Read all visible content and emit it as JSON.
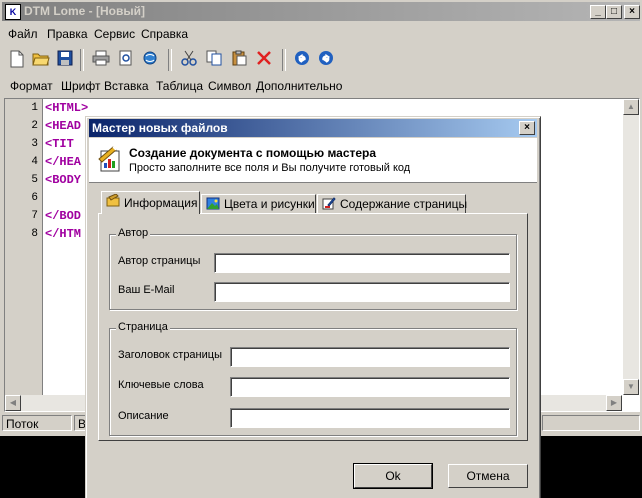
{
  "window": {
    "title": "DTM Lome - [Новый]"
  },
  "menu": [
    "Файл",
    "Правка",
    "Сервис",
    "Справка"
  ],
  "format_bar": [
    "Формат",
    "Шрифт",
    "Вставка",
    "Таблица",
    "Символ",
    "Дополнительно"
  ],
  "editor": {
    "line_numbers": [
      "1",
      "2",
      "3",
      "4",
      "5",
      "6",
      "7",
      "8"
    ],
    "lines": [
      "<HTML>",
      "<HEAD",
      " <TIT",
      "</HEA",
      "<BODY",
      "",
      "</BOD",
      "</HTM"
    ]
  },
  "statusbar": {
    "panel1": "Поток",
    "panel2": "В"
  },
  "dialog": {
    "title": "Мастер новых файлов",
    "header_title": "Создание документа с помощью мастера",
    "header_subtitle": "Просто заполните все поля и Вы получите готовый код",
    "tabs": [
      "Информация",
      "Цвета и рисунки",
      "Содержание страницы"
    ],
    "group_author": {
      "label": "Автор",
      "fields": [
        {
          "label": "Автор страницы",
          "value": ""
        },
        {
          "label": "Ваш E-Mail",
          "value": ""
        }
      ]
    },
    "group_page": {
      "label": "Страница",
      "fields": [
        {
          "label": "Заголовок страницы",
          "value": ""
        },
        {
          "label": "Ключевые слова",
          "value": ""
        },
        {
          "label": "Описание",
          "value": ""
        }
      ]
    },
    "ok_label": "Ok",
    "cancel_label": "Отмена"
  },
  "colors": {
    "titlebar_inactive": "#808080",
    "dialog_title": "#0a246a",
    "tag": "#a000a0"
  }
}
